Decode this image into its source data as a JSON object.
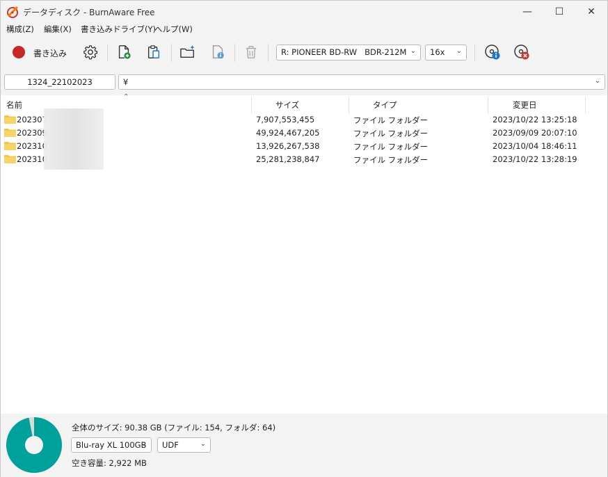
{
  "window": {
    "title": "データディスク - BurnAware Free",
    "minimize": "—",
    "maximize": "☐",
    "close": "✕"
  },
  "menu": [
    "構成(Z)",
    "編集(X)",
    "書き込みドライブ(Y)",
    "ヘルプ(W)"
  ],
  "toolbar": {
    "burn_label": "書き込み",
    "drive": "R: PIONEER BD-RW   BDR-212M",
    "speed": "16x"
  },
  "pathbar": {
    "disc_label": "1324_22102023",
    "path": "¥"
  },
  "columns": [
    "名前",
    "サイズ",
    "タイプ",
    "変更日"
  ],
  "rows": [
    {
      "name": "202307",
      "size": "7,907,553,455",
      "type": "ファイル フォルダー",
      "date": "2023/10/22 13:25:18"
    },
    {
      "name": "202309",
      "size": "49,924,467,205",
      "type": "ファイル フォルダー",
      "date": "2023/09/09 20:07:10"
    },
    {
      "name": "202310",
      "size": "13,926,267,538",
      "type": "ファイル フォルダー",
      "date": "2023/10/04 18:46:11"
    },
    {
      "name": "202310",
      "size": "25,281,238,847",
      "type": "ファイル フォルダー",
      "date": "2023/10/22 13:28:19"
    }
  ],
  "status": {
    "total": "全体のサイズ: 90.38 GB (ファイル: 154, フォルダ: 64)",
    "disc_type": "Blu-ray XL 100GB",
    "filesystem": "UDF",
    "free": "空き容量: 2,922 MB",
    "used_fraction": 0.97
  },
  "colors": {
    "burn": "#c62828",
    "pie": "#00a19a",
    "folder": "#f4c542"
  }
}
